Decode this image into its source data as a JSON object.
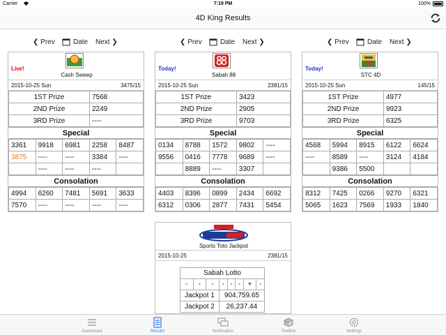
{
  "status": {
    "carrier": "Carrier",
    "time": "7:19 PM",
    "battery": "100%"
  },
  "header": {
    "title": "4D King Results"
  },
  "pager": {
    "prev": "Prev",
    "date": "Date",
    "next": "Next"
  },
  "cards": [
    {
      "tag": "Live!",
      "name": "Cash Sweep",
      "date": "2015-10-25 Sun",
      "draw": "3475/15",
      "prizes": [
        [
          "1ST Prize",
          "7568"
        ],
        [
          "2ND Prize",
          "2249"
        ],
        [
          "3RD Prize",
          "----"
        ]
      ],
      "special_label": "Special",
      "special": [
        [
          "3361",
          "9918",
          "6981",
          "2258",
          "8487"
        ],
        [
          "3875",
          "----",
          "----",
          "3384",
          "----"
        ],
        [
          "",
          "----",
          "----",
          "----",
          ""
        ]
      ],
      "consolation_label": "Consolation",
      "consolation": [
        [
          "4994",
          "6260",
          "7481",
          "5691",
          "3633"
        ],
        [
          "7570",
          "----",
          "----",
          "----",
          "----"
        ]
      ]
    },
    {
      "tag": "Today!",
      "name": "Sabah 88",
      "date": "2015-10-25 Sun",
      "draw": "2381/15",
      "prizes": [
        [
          "1ST Prize",
          "3423"
        ],
        [
          "2ND Prize",
          "2905"
        ],
        [
          "3RD Prize",
          "9703"
        ]
      ],
      "special_label": "Special",
      "special": [
        [
          "0134",
          "8788",
          "1572",
          "9802",
          "----"
        ],
        [
          "9556",
          "0416",
          "7778",
          "9689",
          "----"
        ],
        [
          "",
          "8889",
          "----",
          "3307",
          ""
        ]
      ],
      "consolation_label": "Consolation",
      "consolation": [
        [
          "4403",
          "8396",
          "0899",
          "2434",
          "6692"
        ],
        [
          "6312",
          "0306",
          "2877",
          "7431",
          "5454"
        ]
      ]
    },
    {
      "tag": "Today!",
      "name": "STC 4D",
      "date": "2015-10-25 Sun",
      "draw": "145/15",
      "prizes": [
        [
          "1ST Prize",
          "4977"
        ],
        [
          "2ND Prize",
          "9923"
        ],
        [
          "3RD Prize",
          "6325"
        ]
      ],
      "special_label": "Special",
      "special": [
        [
          "4568",
          "5994",
          "8915",
          "6122",
          "6624"
        ],
        [
          "----",
          "8589",
          "----",
          "3124",
          "4184"
        ],
        [
          "",
          "9386",
          "5500",
          "",
          ""
        ]
      ],
      "consolation_label": "Consolation",
      "consolation": [
        [
          "8312",
          "7425",
          "0266",
          "9270",
          "6321"
        ],
        [
          "5065",
          "1623",
          "7569",
          "1933",
          "1840"
        ]
      ]
    }
  ],
  "lotto": {
    "name": "Sports Toto Jackpot",
    "date": "2015-10-25",
    "draw": "2381/15",
    "title": "Sabah Lotto",
    "numbers": [
      "-",
      "-",
      "-",
      "-",
      "-",
      "-",
      "+",
      "-"
    ],
    "jackpot1_label": "Jackpot 1",
    "jackpot1": "904,759.65",
    "jackpot2_label": "Jackpot 2",
    "jackpot2": "26,237.44"
  },
  "tabs": [
    {
      "label": "Dashboard",
      "icon": "list-icon"
    },
    {
      "label": "Results",
      "icon": "results-icon"
    },
    {
      "label": "Notification",
      "icon": "chat-icon"
    },
    {
      "label": "ToolBox",
      "icon": "toolbox-icon"
    },
    {
      "label": "Settings",
      "icon": "gear-icon"
    }
  ],
  "colors": {
    "accent": "#2f7cf6",
    "live": "#e00000",
    "today": "#2a2ad0",
    "highlight": "#e87c1e"
  }
}
